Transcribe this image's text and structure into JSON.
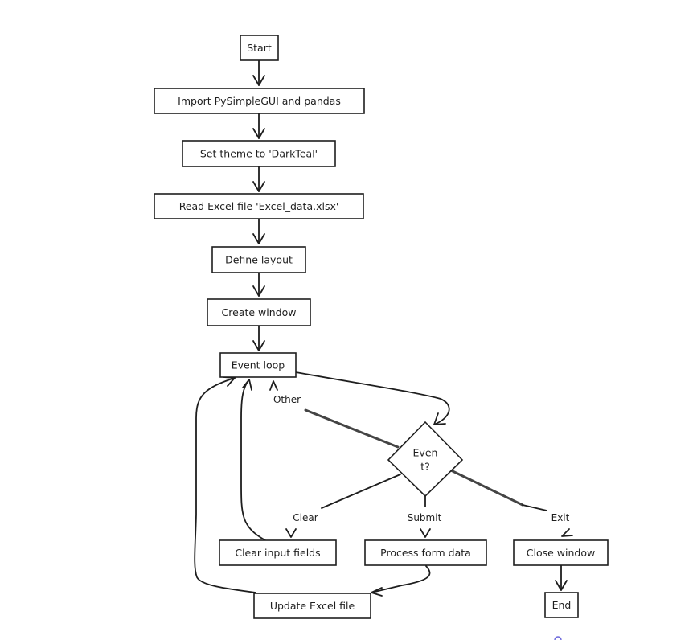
{
  "diagram": {
    "type": "flowchart",
    "nodes": {
      "start": "Start",
      "import": "Import PySimpleGUI and pandas",
      "theme": "Set theme to 'DarkTeal'",
      "read": "Read Excel file 'Excel_data.xlsx'",
      "layout": "Define layout",
      "window": "Create window",
      "loop": "Event loop",
      "decision_line1": "Even",
      "decision_line2": "t?",
      "clear": "Clear input fields",
      "process": "Process form data",
      "close": "Close window",
      "update": "Update Excel file",
      "end": "End"
    },
    "edge_labels": {
      "other": "Other",
      "clear": "Clear",
      "submit": "Submit",
      "exit": "Exit"
    },
    "edges": [
      {
        "from": "start",
        "to": "import"
      },
      {
        "from": "import",
        "to": "theme"
      },
      {
        "from": "theme",
        "to": "read"
      },
      {
        "from": "read",
        "to": "layout"
      },
      {
        "from": "layout",
        "to": "window"
      },
      {
        "from": "window",
        "to": "loop"
      },
      {
        "from": "loop",
        "to": "decision"
      },
      {
        "from": "decision",
        "to": "loop",
        "label": "Other"
      },
      {
        "from": "decision",
        "to": "clear",
        "label": "Clear"
      },
      {
        "from": "decision",
        "to": "process",
        "label": "Submit"
      },
      {
        "from": "decision",
        "to": "close",
        "label": "Exit"
      },
      {
        "from": "clear",
        "to": "loop"
      },
      {
        "from": "process",
        "to": "update"
      },
      {
        "from": "update",
        "to": "loop"
      },
      {
        "from": "close",
        "to": "end"
      }
    ]
  }
}
